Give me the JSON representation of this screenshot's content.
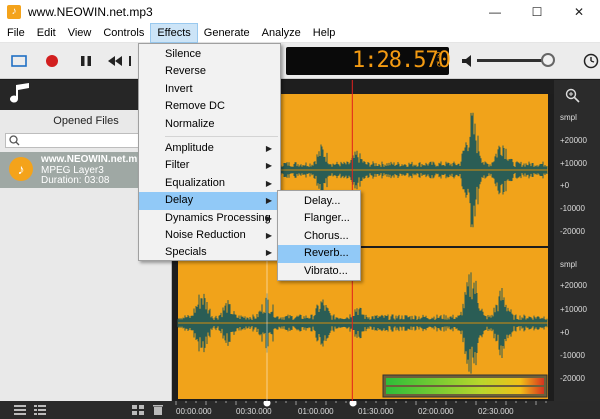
{
  "window": {
    "title": "www.NEOWIN.net.mp3"
  },
  "menu": [
    "File",
    "Edit",
    "View",
    "Controls",
    "Effects",
    "Generate",
    "Analyze",
    "Help"
  ],
  "effects_menu": {
    "items": [
      {
        "label": "Silence"
      },
      {
        "label": "Reverse"
      },
      {
        "label": "Invert"
      },
      {
        "label": "Remove DC"
      },
      {
        "label": "Normalize"
      }
    ],
    "submenus": [
      {
        "label": "Amplitude",
        "arrow": "▶"
      },
      {
        "label": "Filter",
        "arrow": "▶"
      },
      {
        "label": "Equalization",
        "arrow": "▶"
      },
      {
        "label": "Delay",
        "arrow": "▶"
      },
      {
        "label": "Dynamics Processing",
        "arrow": "▶"
      },
      {
        "label": "Noise Reduction",
        "arrow": "▶"
      },
      {
        "label": "Specials",
        "arrow": "▶"
      }
    ]
  },
  "delay_menu": [
    "Delay...",
    "Flanger...",
    "Chorus...",
    "Reverb...",
    "Vibrato..."
  ],
  "display": {
    "time": "1:28.570",
    "mini_top": "?",
    "mini_bottom": "↻"
  },
  "sidebar": {
    "header": "Opened Files",
    "file": {
      "name": "www.NEOWIN.net.mp3",
      "type": "MPEG Layer3",
      "duration": "Duration: 03:08"
    }
  },
  "ruler": [
    "smpl",
    "+20000",
    "+10000",
    "+0",
    "-10000",
    "-20000",
    "smpl",
    "+20000",
    "+10000",
    "+0",
    "-10000",
    "-20000"
  ],
  "timeline": [
    "00:00.000",
    "00:30.000",
    "01:00.000",
    "01:30.000",
    "02:00.000",
    "02:30.000"
  ],
  "colors": {
    "wave_bg": "#f1a31a",
    "wave_fg": "#2a5d55",
    "accent": "#f49b12",
    "playhead": "#e0201e"
  },
  "playhead_position_seconds": 88.57,
  "duration_seconds": 188
}
